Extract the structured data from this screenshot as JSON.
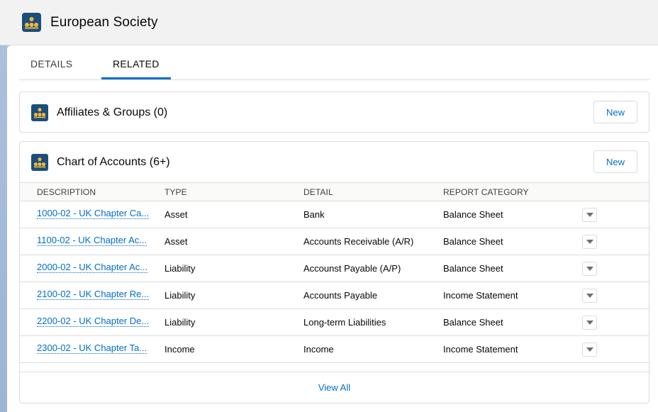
{
  "record": {
    "title": "European Society",
    "icon": "organization-icon"
  },
  "tabs": [
    {
      "label": "DETAILS",
      "active": false
    },
    {
      "label": "RELATED",
      "active": true
    }
  ],
  "affiliates": {
    "title": "Affiliates & Groups (0)",
    "new_label": "New"
  },
  "accounts": {
    "title": "Chart of Accounts (6+)",
    "new_label": "New",
    "columns": [
      "DESCRIPTION",
      "TYPE",
      "DETAIL",
      "REPORT CATEGORY"
    ],
    "rows": [
      {
        "description": "1000-02 - UK Chapter Ca...",
        "type": "Asset",
        "detail": "Bank",
        "category": "Balance Sheet"
      },
      {
        "description": "1100-02 - UK Chapter Ac...",
        "type": "Asset",
        "detail": "Accounts Receivable (A/R)",
        "category": "Balance Sheet"
      },
      {
        "description": "2000-02 - UK Chapter Ac...",
        "type": "Liability",
        "detail": "Accounst Payable (A/P)",
        "category": "Balance Sheet"
      },
      {
        "description": "2100-02 - UK Chapter Re...",
        "type": "Liability",
        "detail": "Accounts Payable",
        "category": "Income Statement"
      },
      {
        "description": "2200-02 - UK Chapter De...",
        "type": "Liability",
        "detail": "Long-term Liabilities",
        "category": "Balance Sheet"
      },
      {
        "description": "2300-02 - UK Chapter Ta...",
        "type": "Income",
        "detail": "Income",
        "category": "Income Statement"
      }
    ],
    "view_all_label": "View All"
  },
  "colors": {
    "accent": "#0070d2",
    "link": "#006dcc",
    "icon_bg": "#1b4e7a",
    "icon_fg": "#f4b53a"
  }
}
